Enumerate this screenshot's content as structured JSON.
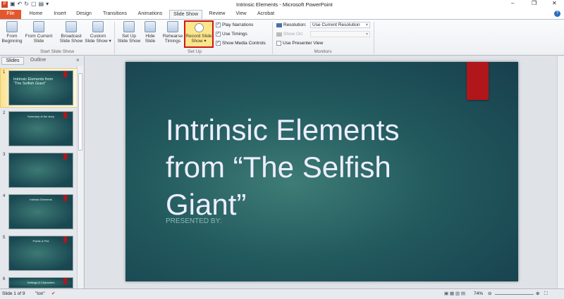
{
  "window": {
    "title": "Intrinsic Elements - Microsoft PowerPoint"
  },
  "tabs": [
    "File",
    "Home",
    "Insert",
    "Design",
    "Transitions",
    "Animations",
    "Slide Show",
    "Review",
    "View",
    "Acrobat"
  ],
  "ribbon": {
    "start_group": "Start Slide Show",
    "setup_group": "Set Up",
    "monitors_group": "Monitors",
    "buttons": {
      "from_beginning": "From Beginning",
      "from_current": "From Current Slide",
      "broadcast": "Broadcast Slide Show",
      "custom": "Custom Slide Show ▾",
      "setup": "Set Up Slide Show",
      "hide": "Hide Slide",
      "rehearse": "Rehearse Timings",
      "record": "Record Slide Show ▾"
    },
    "checks": {
      "play_narrations": "Play Narrations",
      "use_timings": "Use Timings",
      "show_media": "Show Media Controls",
      "presenter_view": "Use Presenter View"
    },
    "resolution_label": "Resolution:",
    "resolution_value": "Use Current Resolution",
    "show_on_label": "Show On:"
  },
  "panel": {
    "tabs": [
      "Slides",
      "Outline"
    ],
    "thumbs": [
      {
        "n": "1",
        "title": "Intrinsic Elements from “The Selfish Giant”"
      },
      {
        "n": "2",
        "title": "Summary of the story"
      },
      {
        "n": "3",
        "title": ""
      },
      {
        "n": "4",
        "title": "Intrinsic Elements"
      },
      {
        "n": "5",
        "title": "Points & Plot"
      },
      {
        "n": "6",
        "title": "Settings & Characters"
      }
    ]
  },
  "slide": {
    "title": "Intrinsic Elements from “The Selfish Giant”",
    "subtitle": "PRESENTED BY:"
  },
  "status": {
    "slide": "Slide 1 of 9",
    "theme": "\"Ion\"",
    "zoom": "74%"
  },
  "colors": {
    "file_tab": "#e4572e",
    "highlight": "#d0161c",
    "accent_red": "#b0161a"
  }
}
